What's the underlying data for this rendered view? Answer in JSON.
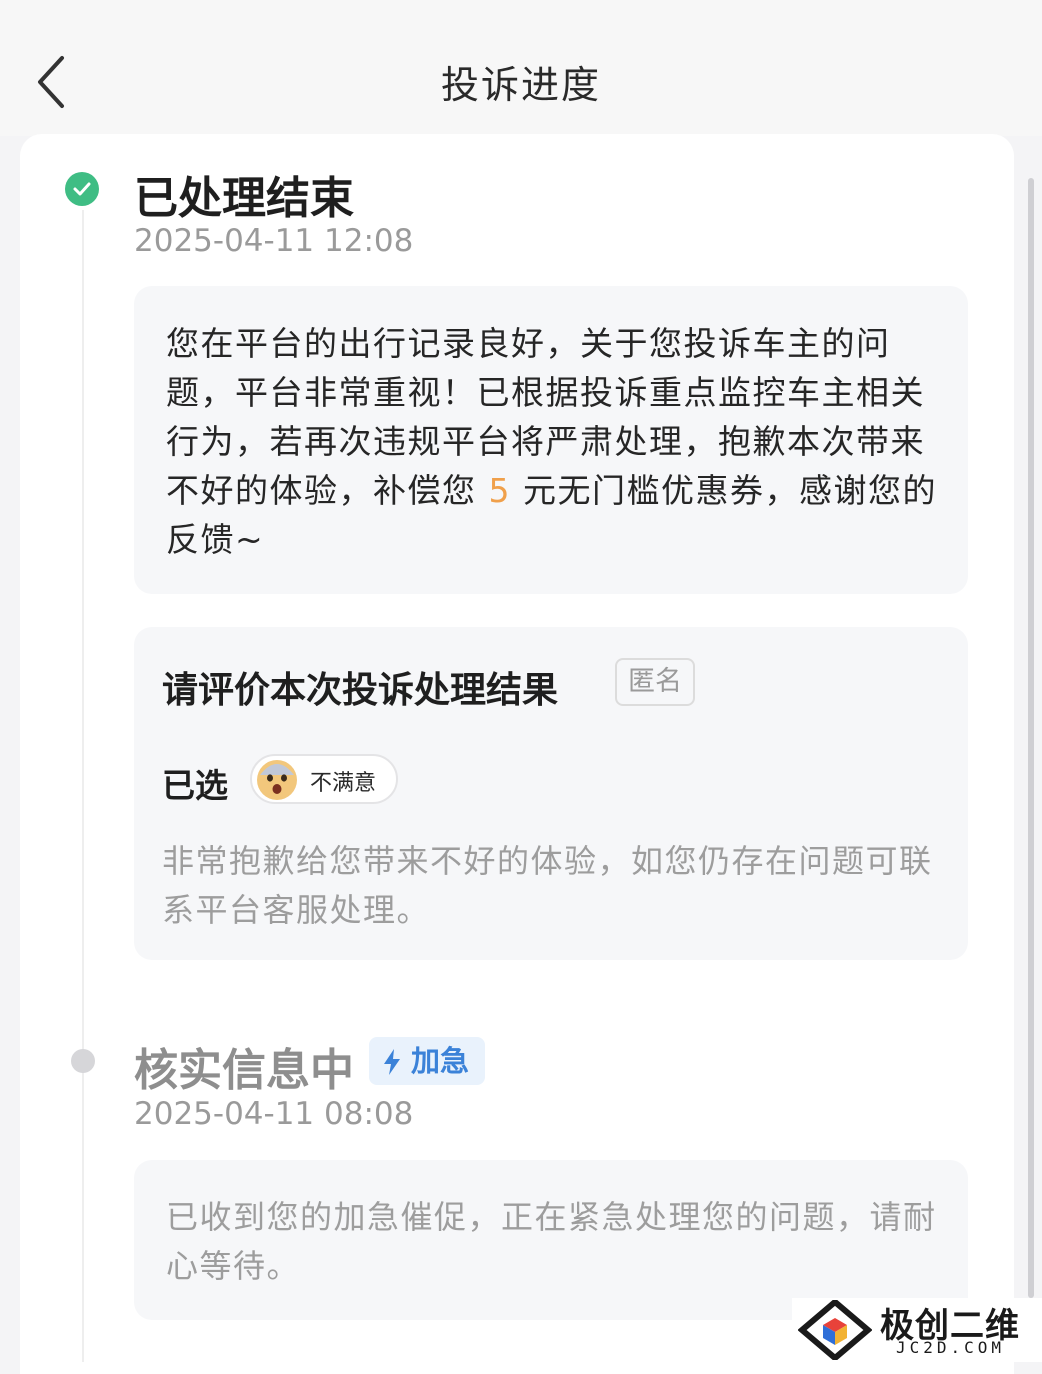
{
  "header": {
    "title": "投诉进度",
    "back_icon": "chevron-left-icon"
  },
  "timeline": [
    {
      "title": "已处理结束",
      "time": "2025-04-11 12:08",
      "status": "done",
      "status_color": "#3fbd84",
      "message_parts": [
        "您在平台的出行记录良好，关于您投诉车主的问题，平台非常重视！已根据投诉重点监控车主相关行为，若再次违规平台将严肃处理，抱歉本次带来不好的体验，补偿您",
        "5",
        "元无门槛优惠券，感谢您的反馈~"
      ],
      "highlight_color": "#f0a04b"
    },
    {
      "title": "核实信息中",
      "time": "2025-04-11 08:08",
      "status": "pending",
      "badge": "加急",
      "badge_color": "#3b82d8",
      "message": "已收到您的加急催促，正在紧急处理您的问题，请耐心等待。"
    }
  ],
  "evaluation": {
    "title": "请评价本次投诉处理结果",
    "anonymous_tag": "匿名",
    "selected_label": "已选",
    "rating_icon": "dissatisfied-emoji-icon",
    "rating_text": "不满意",
    "apology": "非常抱歉给您带来不好的体验，如您仍存在问题可联系平台客服处理。"
  },
  "watermark": {
    "cn": "极创二维",
    "en": "JC2D.COM"
  }
}
